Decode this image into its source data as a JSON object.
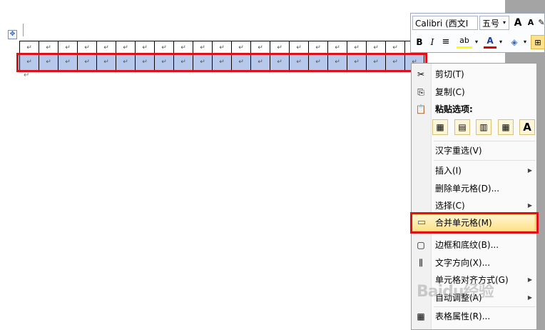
{
  "document": {
    "move_handle_icon": "move-cross-icon",
    "cell_mark": "↵",
    "paragraph_mark": "↵",
    "columns": 21
  },
  "toolbar": {
    "font_name": "Calibri (西文I",
    "font_size": "五号",
    "grow_font": "A",
    "shrink_font": "A",
    "bold": "B",
    "italic": "I",
    "highlight_label": "ab",
    "font_color_label": "A",
    "highlight_color": "#ffff00",
    "font_color": "#e00000"
  },
  "context_menu": {
    "cut": "剪切(T)",
    "copy": "复制(C)",
    "paste_options": "粘贴选项:",
    "paste_buttons": [
      "嵌套表",
      "合并表",
      "插入为新行",
      "覆盖单元格",
      "A"
    ],
    "reconvert": "汉字重选(V)",
    "insert": "插入(I)",
    "delete_cells": "删除单元格(D)...",
    "select": "选择(C)",
    "merge_cells": "合并单元格(M)",
    "borders": "边框和底纹(B)...",
    "text_direction": "文字方向(X)...",
    "cell_alignment": "单元格对齐方式(G)",
    "autofit": "自动调整(A)",
    "table_properties": "表格属性(R)..."
  },
  "watermark": "Baidu经验",
  "colors": {
    "selection": "#b6c8ec",
    "highlight_border": "#e0101a",
    "menu_hover": "#fde28a"
  }
}
